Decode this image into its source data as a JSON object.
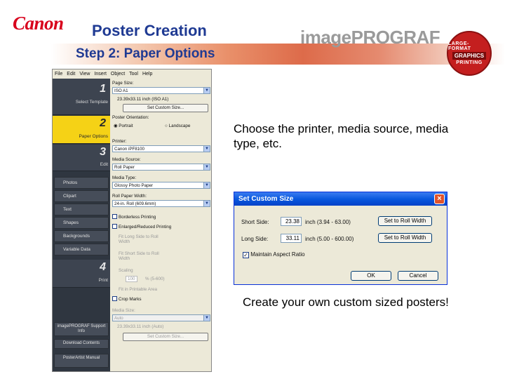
{
  "header": {
    "brand": "Canon",
    "title": "Poster Creation",
    "subtitle": "Step 2: Paper Options",
    "product_logo": "imagePROGRAF",
    "badge_top": "LARGE-FORMAT",
    "badge_mid": "GRAPHICS",
    "badge_bot": "PRINTING"
  },
  "app": {
    "menu": [
      "File",
      "Edit",
      "View",
      "Insert",
      "Object",
      "Tool",
      "Help"
    ],
    "steps": [
      {
        "num": "1",
        "label": "Select Template"
      },
      {
        "num": "2",
        "label": "Paper Options"
      },
      {
        "num": "3",
        "label": "Edit"
      },
      {
        "num": "4",
        "label": "Print"
      }
    ],
    "edit_items": [
      "Photos",
      "Clipart",
      "Text",
      "Shapes",
      "Backgrounds",
      "Variable Data"
    ],
    "bottom_buttons": [
      "imagePROGRAF Support Info",
      "Download Contents",
      "PosterArtist Manual"
    ],
    "paper_size_label": "Page Size:",
    "paper_size_value": "ISO A1",
    "paper_size_dims": "23.39x33.11 inch (ISO A1)",
    "set_custom_size": "Set Custom Size...",
    "orientation_label": "Poster Orientation:",
    "portrait": "Portrait",
    "landscape": "Landscape",
    "printer_label": "Printer:",
    "printer_value": "Canon iPF8100",
    "media_source_label": "Media Source:",
    "media_source_value": "Roll Paper",
    "media_type_label": "Media Type:",
    "media_type_value": "Glossy Photo Paper",
    "roll_width_label": "Roll Paper Width:",
    "roll_width_value": "24-in. Roll (609.6mm)",
    "borderless": "Borderless Printing",
    "enlarge": "Enlarged/Reduced Printing",
    "fit_long": "Fit Long Side to Roll Width",
    "fit_short": "Fit Short Side to Roll Width",
    "scaling": "Scaling",
    "scaling_value": "100",
    "scaling_range": "% (5-600)",
    "fit_printable": "Fit in Printable Area",
    "crop_marks": "Crop Marks",
    "media_size_label": "Media Size:",
    "media_size_value": "Auto",
    "media_size_dims": "23.39x33.11 inch (Auto)",
    "set_custom_size_2": "Set Custom Size..."
  },
  "body": {
    "text_1": "Choose the printer, media source, media type, etc.",
    "text_2": "Create your own custom sized posters!"
  },
  "dialog": {
    "title": "Set Custom Size",
    "close": "×",
    "short_side_label": "Short Side:",
    "short_side_value": "23.38",
    "short_side_unit": "inch (3.94 - 63.00)",
    "long_side_label": "Long Side:",
    "long_side_value": "33.11",
    "long_side_unit": "inch (5.00 - 600.00)",
    "set_roll_width": "Set to Roll Width",
    "maintain_aspect": "Maintain Aspect Ratio",
    "ok": "OK",
    "cancel": "Cancel"
  }
}
